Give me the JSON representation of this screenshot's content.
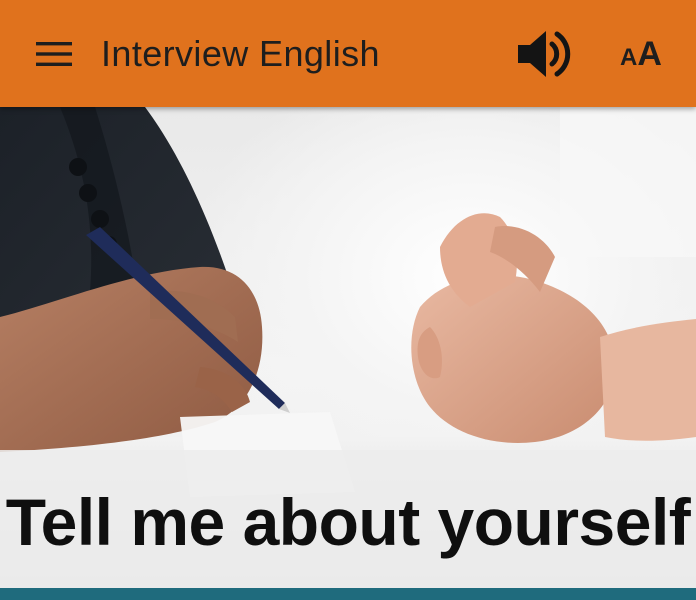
{
  "appbar": {
    "title": "Interview English",
    "menu_icon": "hamburger-menu-icon",
    "speaker_icon": "speaker-volume-icon",
    "font_size": {
      "small": "A",
      "large": "A"
    },
    "background_color": "#e0721d"
  },
  "hero": {
    "caption": "Tell me about yourself"
  },
  "accent_color": "#1f6b7d"
}
